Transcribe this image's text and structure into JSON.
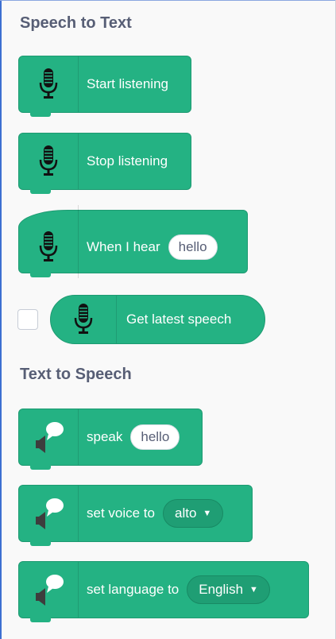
{
  "categories": {
    "speech_to_text": "Speech to Text",
    "text_to_speech": "Text to Speech"
  },
  "blocks": {
    "start_listening": "Start listening",
    "stop_listening": "Stop listening",
    "when_i_hear": {
      "label": "When I hear",
      "value": "hello"
    },
    "get_latest_speech": "Get latest speech",
    "speak": {
      "label": "speak",
      "value": "hello"
    },
    "set_voice": {
      "label": "set voice to",
      "value": "alto"
    },
    "set_language": {
      "label": "set language to",
      "value": "English"
    }
  },
  "icons": {
    "microphone": "microphone-icon",
    "speech_bubble": "speaker-speech-bubble-icon"
  },
  "colors": {
    "block_green": "#24b283",
    "category_title": "#575e75"
  }
}
